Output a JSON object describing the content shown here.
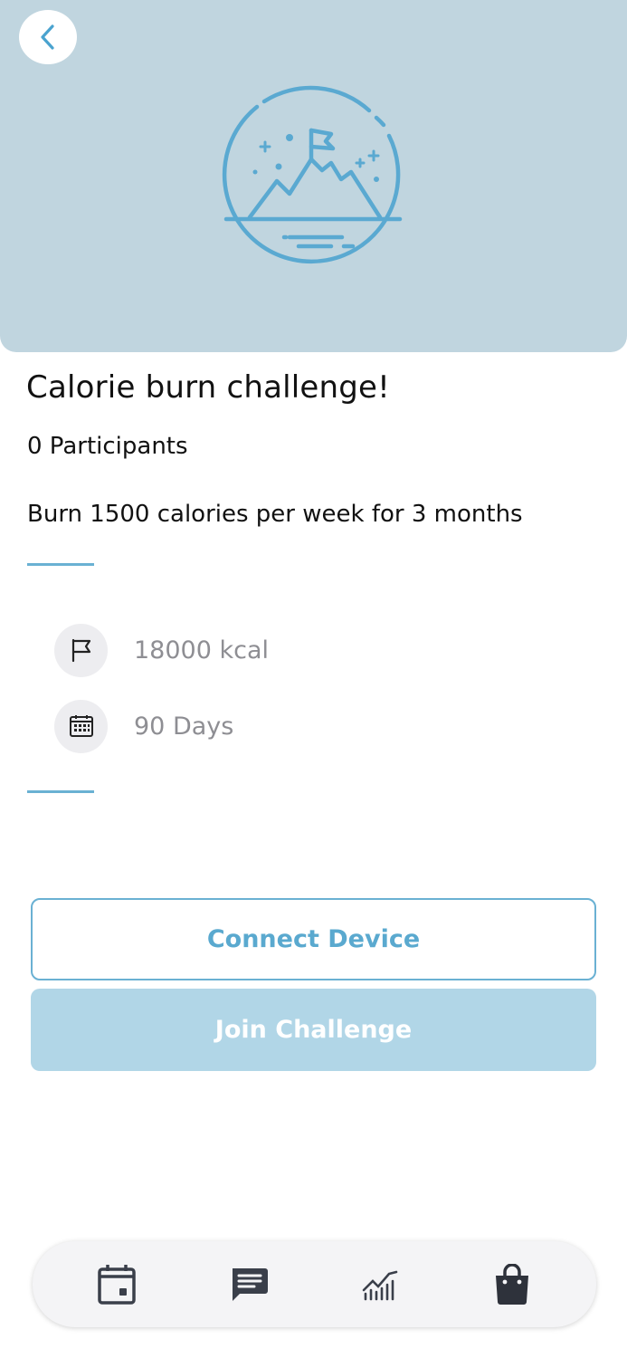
{
  "header": {
    "back_icon": "chevron-left-icon",
    "illustration": "mountain-flag-icon",
    "background_color": "#c0d5df"
  },
  "challenge": {
    "title": "Calorie burn challenge!",
    "participants": "0 Participants",
    "description": "Burn 1500 calories per week for 3 months"
  },
  "stats": [
    {
      "icon": "flag-icon",
      "text": "18000 kcal"
    },
    {
      "icon": "calendar-icon",
      "text": "90 Days"
    }
  ],
  "actions": {
    "connect_label": "Connect Device",
    "join_label": "Join Challenge"
  },
  "bottom_nav": {
    "items": [
      {
        "icon": "calendar-icon"
      },
      {
        "icon": "chat-icon"
      },
      {
        "icon": "chart-icon"
      },
      {
        "icon": "shopping-bag-icon"
      }
    ]
  },
  "colors": {
    "accent": "#6ab1d3",
    "join_button": "#b1d6e7",
    "stat_text": "#8e8e93",
    "nav_icon": "#3a3f4a"
  }
}
